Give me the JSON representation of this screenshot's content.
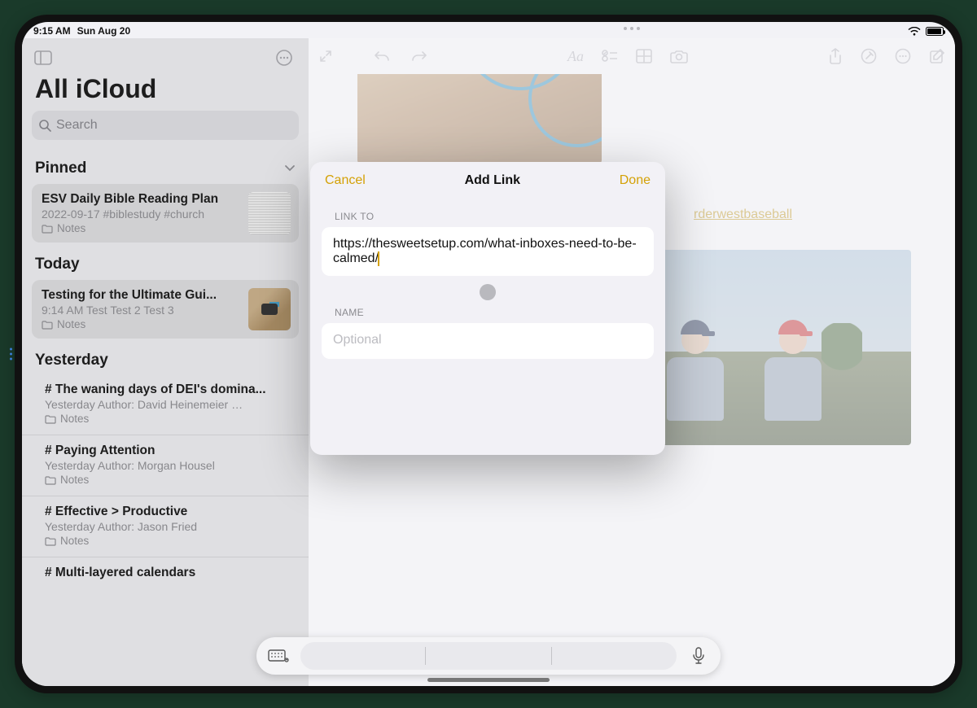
{
  "status": {
    "time": "9:15 AM",
    "date": "Sun Aug 20"
  },
  "sidebar": {
    "title": "All iCloud",
    "search_placeholder": "Search",
    "sections": {
      "pinned": "Pinned",
      "today": "Today",
      "yesterday": "Yesterday"
    },
    "pinned": [
      {
        "title": "ESV Daily Bible Reading Plan",
        "sub": "2022-09-17  #biblestudy #church",
        "folder": "Notes"
      }
    ],
    "today": [
      {
        "title": "Testing for the Ultimate Gui...",
        "sub": "9:14 AM  Test Test 2 Test 3",
        "folder": "Notes"
      }
    ],
    "yesterday": [
      {
        "title": "# The waning days of DEI's domina...",
        "sub": "Yesterday  Author: David Heinemeier Han...",
        "folder": "Notes"
      },
      {
        "title": "# Paying Attention",
        "sub": "Yesterday  Author: Morgan Housel",
        "folder": "Notes"
      },
      {
        "title": "# Effective > Productive",
        "sub": "Yesterday  Author: Jason Fried",
        "folder": "Notes"
      },
      {
        "title": "# Multi-layered calendars",
        "sub": "",
        "folder": ""
      }
    ]
  },
  "editor": {
    "link_in_body": "rderwestbaseball"
  },
  "modal": {
    "cancel": "Cancel",
    "title": "Add Link",
    "done": "Done",
    "link_to_label": "LINK TO",
    "link_to_value": "https://thesweetsetup.com/what-inboxes-need-to-be-calmed/",
    "name_label": "NAME",
    "name_placeholder": "Optional"
  }
}
